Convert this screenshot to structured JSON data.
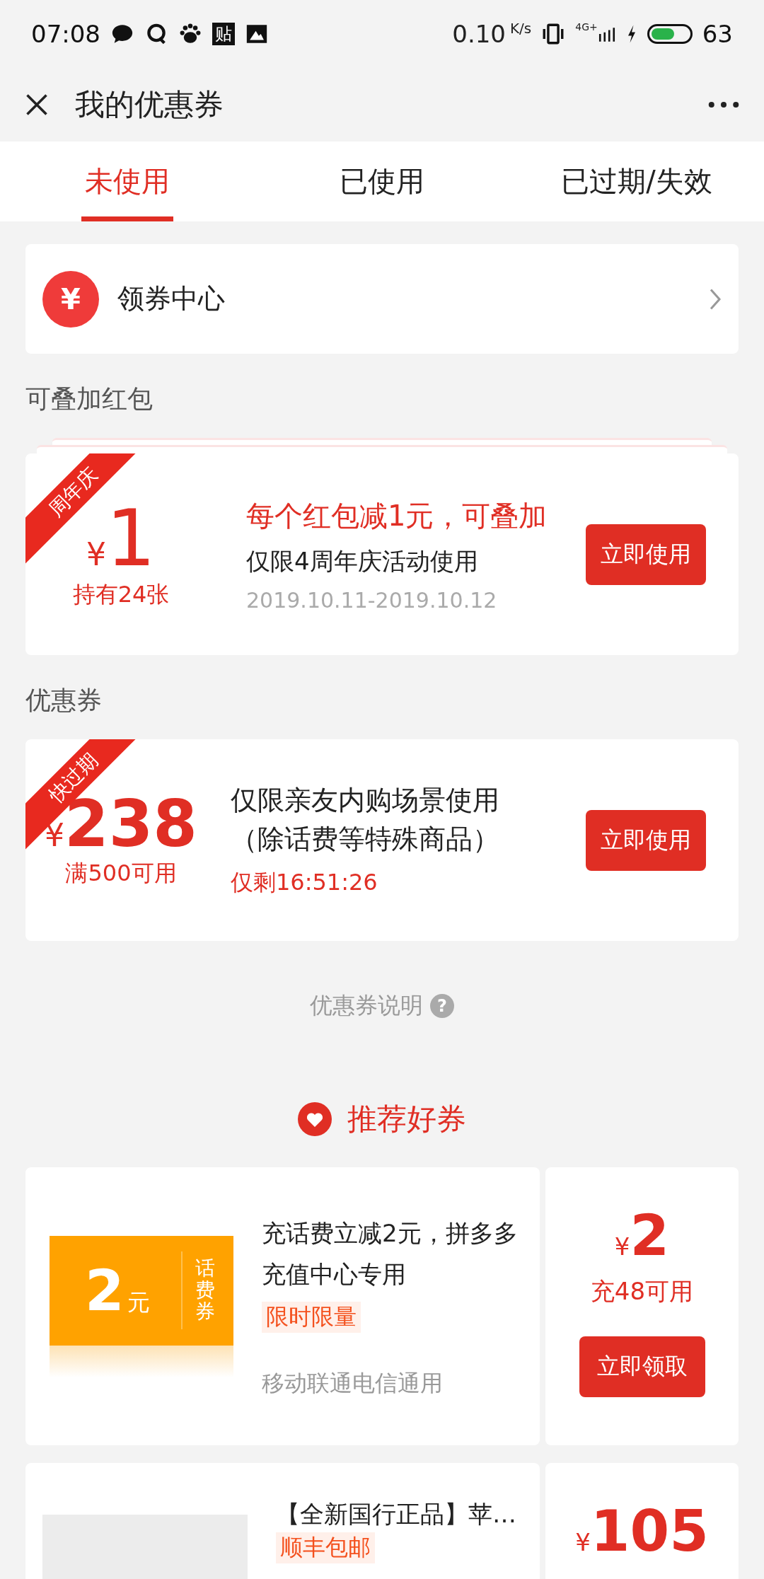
{
  "status_bar": {
    "time": "07:08",
    "badge_text": "贴",
    "net_speed": "0.10",
    "net_unit": "K/s",
    "network_type": "4G+",
    "battery": "63"
  },
  "header": {
    "title": "我的优惠券"
  },
  "tabs": [
    {
      "label": "未使用",
      "selected": true
    },
    {
      "label": "已使用",
      "selected": false
    },
    {
      "label": "已过期/失效",
      "selected": false
    }
  ],
  "coupon_center": {
    "label": "领券中心",
    "icon_glyph": "¥"
  },
  "red_packet_section": {
    "title": "可叠加红包",
    "cards": [
      {
        "ribbon": "周年庆",
        "currency": "¥",
        "amount": "1",
        "sub": "持有24张",
        "headline": "每个红包减1元，可叠加",
        "desc": "仅限4周年庆活动使用",
        "date": "2019.10.11-2019.10.12",
        "button": "立即使用"
      }
    ]
  },
  "coupon_section": {
    "title": "优惠券",
    "cards": [
      {
        "ribbon": "快过期",
        "currency": "¥",
        "amount": "238",
        "sub": "满500可用",
        "desc_lines": [
          "仅限亲友内购场景使用",
          "（除话费等特殊商品）"
        ],
        "countdown": "仅剩16:51:26",
        "button": "立即使用"
      }
    ]
  },
  "help_link": {
    "label": "优惠券说明",
    "icon_glyph": "?"
  },
  "recommend": {
    "title": "推荐好券",
    "items": [
      {
        "kind": "voucher",
        "voucher_amount": "2",
        "voucher_unit": "元",
        "voucher_type": "话费券",
        "title": "充话费立减2元，拼多多充值中心专用",
        "tag": "限时限量",
        "note": "移动联通电信通用",
        "currency": "¥",
        "price": "2",
        "condition": "充48可用",
        "button": "立即领取"
      },
      {
        "kind": "product",
        "title": "【全新国行正品】苹…",
        "tag": "顺丰包邮",
        "currency": "¥",
        "price": "105"
      }
    ]
  }
}
